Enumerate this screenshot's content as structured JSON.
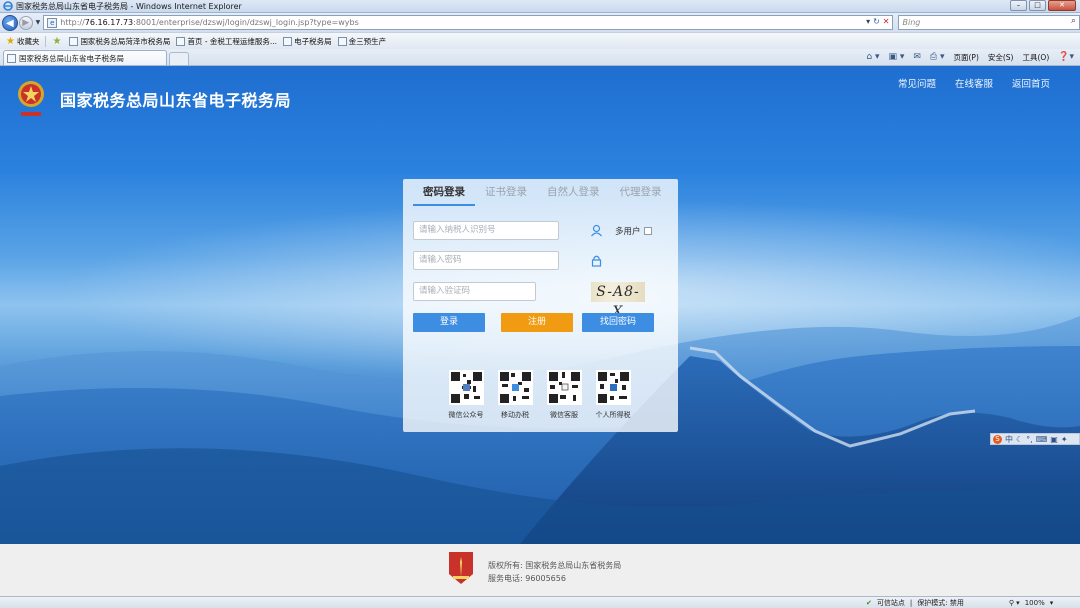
{
  "browser": {
    "window_title": "国家税务总局山东省电子税务局 - Windows Internet Explorer",
    "url_prefix": "http://",
    "url_host": "76.16.17.73",
    "url_rest": ":8001/enterprise/dzswj/login/dzswj_login.jsp?type=wybs",
    "search_placeholder": "Bing",
    "favorites_label": "收藏夹",
    "favorites": [
      "国家税务总局菏泽市税务局",
      "首页 - 金税工程运维服务...",
      "电子税务局",
      "金三预生产"
    ],
    "active_tab": "国家税务总局山东省电子税务局",
    "commands": {
      "page": "页面(P)",
      "safety": "安全(S)",
      "tools": "工具(O)"
    },
    "status": {
      "zone": "可信站点",
      "protected_mode": "保护模式: 禁用",
      "zoom": "100%"
    }
  },
  "site": {
    "title": "国家税务总局山东省电子税务局",
    "nav": [
      "常见问题",
      "在线客服",
      "返回首页"
    ]
  },
  "login": {
    "tabs": [
      "密码登录",
      "证书登录",
      "自然人登录",
      "代理登录"
    ],
    "active_tab_index": 0,
    "taxpayer_id_placeholder": "请输入纳税人识别号",
    "password_placeholder": "请输入密码",
    "captcha_placeholder": "请输入验证码",
    "multi_user_label": "多用户",
    "multi_user_checked": false,
    "captcha_text": "S-A8-X",
    "buttons": {
      "login": "登录",
      "register": "注册",
      "recover": "找回密码"
    },
    "qr_codes": [
      "微信公众号",
      "移动办税",
      "微信客服",
      "个人所得税"
    ]
  },
  "ime_bar": "中",
  "footer": {
    "copyright": "版权所有: 国家税务总局山东省税务局",
    "phone": "服务电话: 96005656"
  },
  "colors": {
    "primary_button": "#3d8de3",
    "register_button": "#f19b12",
    "sky_top": "#1f6ed0"
  }
}
